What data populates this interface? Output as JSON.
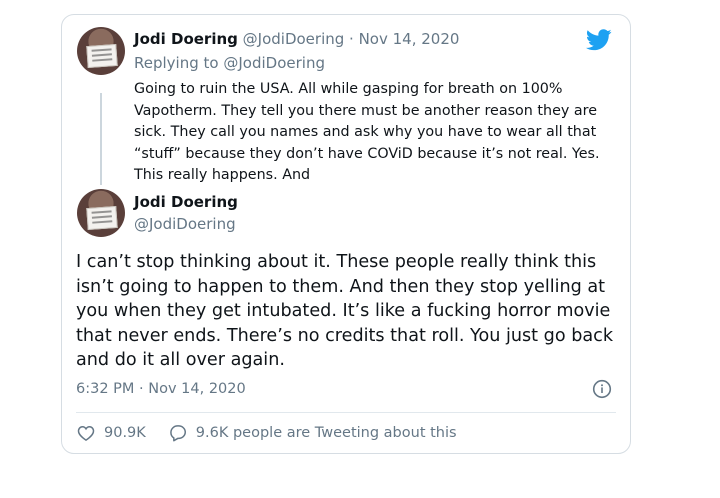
{
  "parent": {
    "name": "Jodi Doering",
    "handle": "@JodiDoering",
    "separator": " · ",
    "date": "Nov 14, 2020",
    "replying_label": "Replying to",
    "replying_to": "@JodiDoering",
    "text": "Going to ruin the USA. All while gasping for breath on 100% Vapotherm.  They tell you there must be another reason they are sick. They call you names and ask why you have to wear all that “stuff” because they don’t have COViD because it’s not real. Yes. This really happens. And"
  },
  "tweet": {
    "name": "Jodi Doering",
    "handle": "@JodiDoering",
    "text": "I can’t stop thinking about it. These people really think this isn’t going to happen to them.  And then they stop yelling at you when they get intubated. It’s like a fucking horror movie that never ends. There’s no credits that roll. You just go back and do it all over again.",
    "time": "6:32 PM · Nov 14, 2020"
  },
  "actions": {
    "likes": "90.9K",
    "tweeting": "9.6K people are Tweeting about this"
  },
  "colors": {
    "twitter_blue": "#1da1f2",
    "muted": "#657786",
    "text": "#0f1419"
  },
  "icons": [
    "twitter-logo-icon",
    "info-icon",
    "heart-icon",
    "speech-bubble-icon"
  ]
}
